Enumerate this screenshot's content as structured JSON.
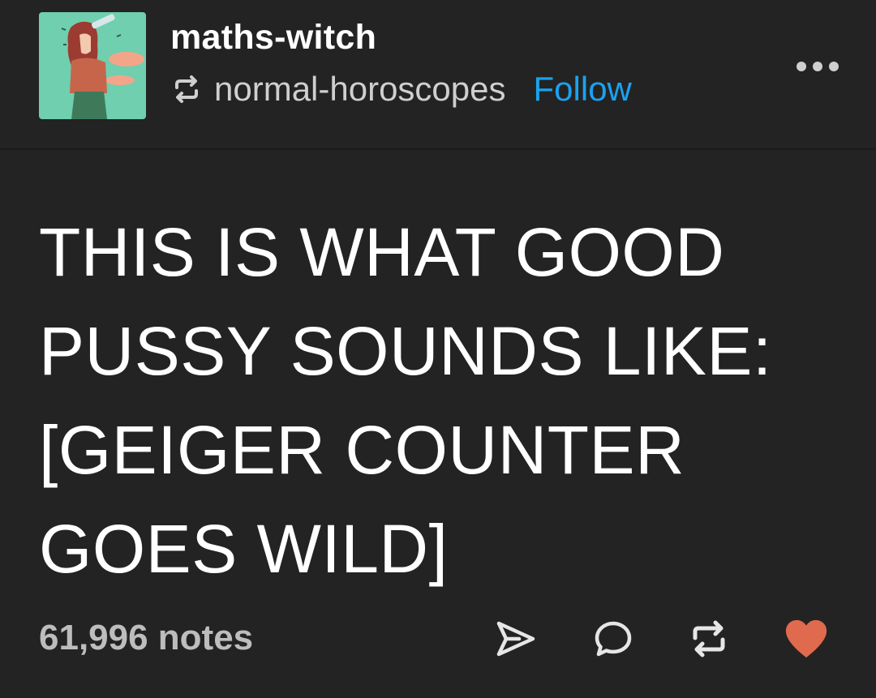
{
  "post": {
    "blog_name": "maths-witch",
    "reblog_source": "normal-horoscopes",
    "follow_label": "Follow",
    "body_lines": [
      "THIS IS WHAT GOOD",
      "PUSSY SOUNDS LIKE:",
      "[GEIGER COUNTER",
      "GOES WILD]"
    ],
    "notes_label": "61,996 notes"
  },
  "icons": {
    "avatar": "avatar-illustration",
    "reblog": "reblog-icon",
    "more": "more-options-icon",
    "share": "share-icon",
    "reply": "reply-icon",
    "reblog_action": "reblog-icon",
    "like": "heart-icon"
  },
  "colors": {
    "background": "#232323",
    "follow": "#1aa2f0",
    "like": "#e06a4d",
    "secondary_text": "#cfcfcf"
  }
}
